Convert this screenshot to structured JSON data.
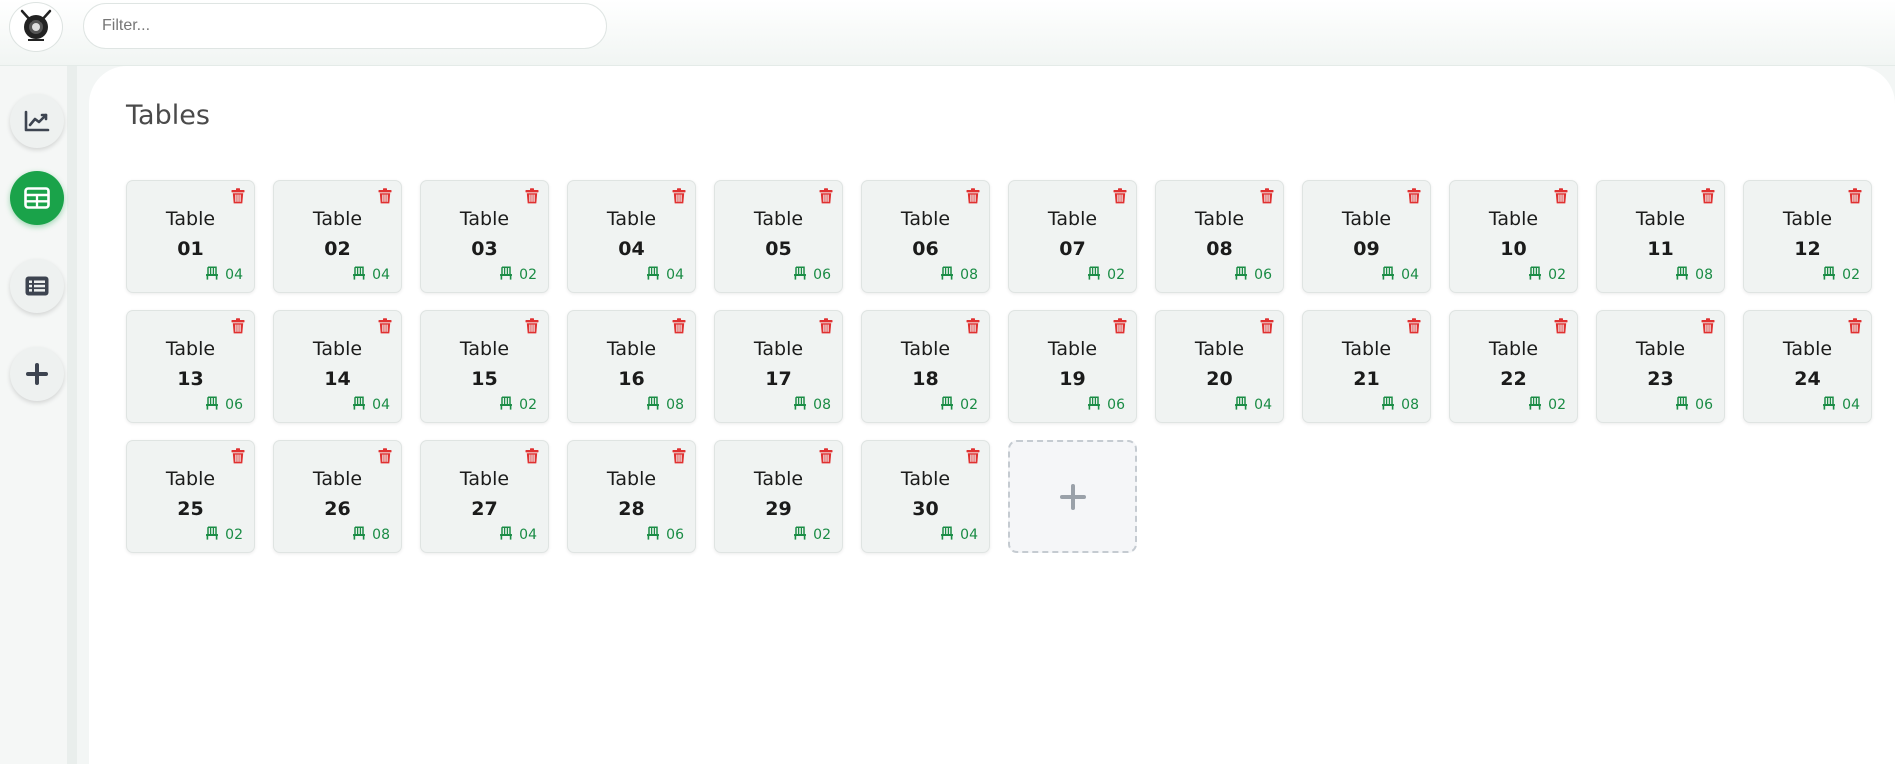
{
  "header": {
    "filter_placeholder": "Filter..."
  },
  "sidebar": {
    "items": [
      {
        "icon": "chart-line-icon",
        "active": false
      },
      {
        "icon": "table-icon",
        "active": true
      },
      {
        "icon": "list-icon",
        "active": false
      },
      {
        "icon": "plus-icon",
        "active": false
      }
    ]
  },
  "page": {
    "title": "Tables"
  },
  "colors": {
    "accent": "#1aa34a",
    "delete": "#e03131",
    "seats": "#1a8c45"
  },
  "tables": [
    {
      "label": "Table",
      "number": "01",
      "seats": "04"
    },
    {
      "label": "Table",
      "number": "02",
      "seats": "04"
    },
    {
      "label": "Table",
      "number": "03",
      "seats": "02"
    },
    {
      "label": "Table",
      "number": "04",
      "seats": "04"
    },
    {
      "label": "Table",
      "number": "05",
      "seats": "06"
    },
    {
      "label": "Table",
      "number": "06",
      "seats": "08"
    },
    {
      "label": "Table",
      "number": "07",
      "seats": "02"
    },
    {
      "label": "Table",
      "number": "08",
      "seats": "06"
    },
    {
      "label": "Table",
      "number": "09",
      "seats": "04"
    },
    {
      "label": "Table",
      "number": "10",
      "seats": "02"
    },
    {
      "label": "Table",
      "number": "11",
      "seats": "08"
    },
    {
      "label": "Table",
      "number": "12",
      "seats": "02"
    },
    {
      "label": "Table",
      "number": "13",
      "seats": "06"
    },
    {
      "label": "Table",
      "number": "14",
      "seats": "04"
    },
    {
      "label": "Table",
      "number": "15",
      "seats": "02"
    },
    {
      "label": "Table",
      "number": "16",
      "seats": "08"
    },
    {
      "label": "Table",
      "number": "17",
      "seats": "08"
    },
    {
      "label": "Table",
      "number": "18",
      "seats": "02"
    },
    {
      "label": "Table",
      "number": "19",
      "seats": "06"
    },
    {
      "label": "Table",
      "number": "20",
      "seats": "04"
    },
    {
      "label": "Table",
      "number": "21",
      "seats": "08"
    },
    {
      "label": "Table",
      "number": "22",
      "seats": "02"
    },
    {
      "label": "Table",
      "number": "23",
      "seats": "06"
    },
    {
      "label": "Table",
      "number": "24",
      "seats": "04"
    },
    {
      "label": "Table",
      "number": "25",
      "seats": "02"
    },
    {
      "label": "Table",
      "number": "26",
      "seats": "08"
    },
    {
      "label": "Table",
      "number": "27",
      "seats": "04"
    },
    {
      "label": "Table",
      "number": "28",
      "seats": "06"
    },
    {
      "label": "Table",
      "number": "29",
      "seats": "02"
    },
    {
      "label": "Table",
      "number": "30",
      "seats": "04"
    }
  ],
  "add_card": {
    "icon": "plus-icon"
  }
}
